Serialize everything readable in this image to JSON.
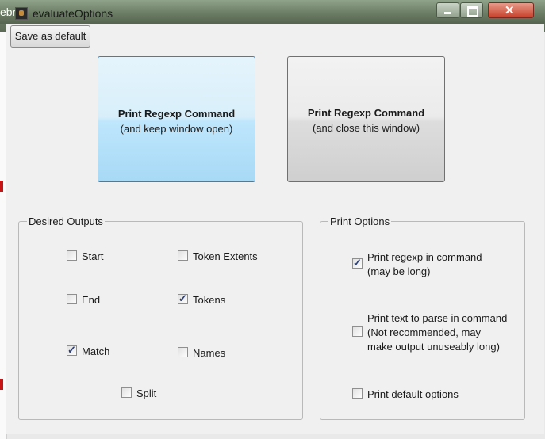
{
  "window": {
    "app_fragment": "ebra",
    "title": "evaluateOptions",
    "close_glyph": "✕"
  },
  "toolbar": {
    "save_default_label": "Save as default"
  },
  "buttons": {
    "print_keep": {
      "line1": "Print Regexp Command",
      "line2": "(and keep window open)"
    },
    "print_close": {
      "line1": "Print Regexp Command",
      "line2": "(and close this window)"
    }
  },
  "desired_outputs": {
    "legend": "Desired Outputs",
    "start": {
      "label": "Start",
      "checked": false
    },
    "end": {
      "label": "End",
      "checked": false
    },
    "match": {
      "label": "Match",
      "checked": true
    },
    "split": {
      "label": "Split",
      "checked": false
    },
    "token_extents": {
      "label": "Token Extents",
      "checked": false
    },
    "tokens": {
      "label": "Tokens",
      "checked": true
    },
    "names": {
      "label": "Names",
      "checked": false
    }
  },
  "print_options": {
    "legend": "Print Options",
    "regexp_in_command": {
      "line1": "Print regexp in command",
      "line2": "(may be long)",
      "checked": true
    },
    "text_to_parse": {
      "line1": "Print text to parse in command",
      "line2": "(Not recommended, may",
      "line3": "make output unuseably long)",
      "checked": false
    },
    "default_options": {
      "label": "Print default options",
      "checked": false
    }
  },
  "colors": {
    "accent_button": "#bee6fd",
    "check_mark": "#2c3e74",
    "close_button": "#c7412b"
  }
}
